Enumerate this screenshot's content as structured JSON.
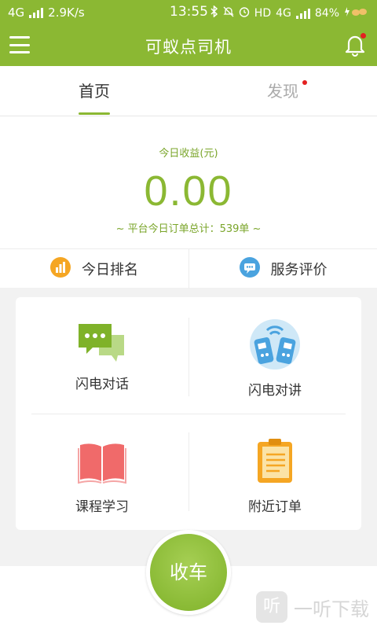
{
  "statusbar": {
    "network": "4G",
    "speed": "2.9K/s",
    "time": "13:55",
    "right_text": "HD",
    "net2": "4G",
    "battery": "84%"
  },
  "appbar": {
    "title": "可蚁点司机",
    "menu_icon": "menu-icon",
    "bell_icon": "bell-icon"
  },
  "tabs": [
    {
      "label": "首页",
      "active": true
    },
    {
      "label": "发现",
      "active": false
    }
  ],
  "earnings": {
    "label": "今日收益(元)",
    "value": "0.00",
    "total": "~ 平台今日订单总计：539单 ~"
  },
  "quick": [
    {
      "label": "今日排名",
      "icon": "ranking-icon",
      "color": "#f5a623"
    },
    {
      "label": "服务评价",
      "icon": "review-icon",
      "color": "#4aa3df"
    }
  ],
  "grid": [
    {
      "label": "闪电对话",
      "icon": "chat-icon"
    },
    {
      "label": "闪电对讲",
      "icon": "walkie-talkie-icon"
    },
    {
      "label": "课程学习",
      "icon": "book-icon"
    },
    {
      "label": "附近订单",
      "icon": "clipboard-icon"
    }
  ],
  "main_button": {
    "label": "收车"
  },
  "watermark": {
    "text": "一听下载",
    "icon_text": "听"
  },
  "colors": {
    "brand": "#8bb833",
    "badge": "#e32020"
  }
}
